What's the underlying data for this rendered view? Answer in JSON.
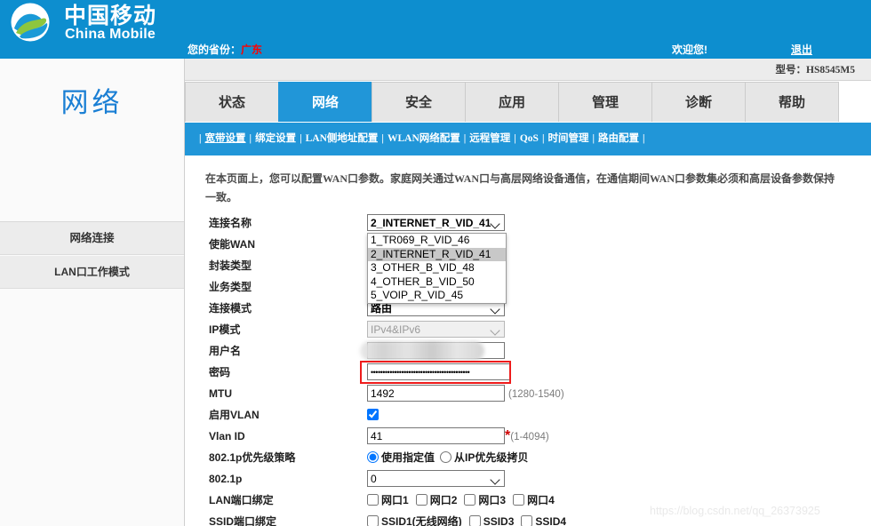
{
  "header": {
    "brand_cn": "中国移动",
    "brand_en": "China Mobile",
    "logo_icon": "china-mobile-logo-icon",
    "province_label": "您的省份：",
    "province_value": "广东",
    "welcome": "欢迎您!",
    "logout": "退出",
    "model_text": "型号：HS8545M5",
    "blue": "#0d8ecf"
  },
  "sidebar": {
    "title": "网络",
    "items": [
      {
        "label": "网络连接"
      },
      {
        "label": "LAN口工作模式"
      }
    ]
  },
  "tabs": [
    {
      "label": "状态",
      "active": false
    },
    {
      "label": "网络",
      "active": true
    },
    {
      "label": "安全",
      "active": false
    },
    {
      "label": "应用",
      "active": false
    },
    {
      "label": "管理",
      "active": false
    },
    {
      "label": "诊断",
      "active": false
    },
    {
      "label": "帮助",
      "active": false
    }
  ],
  "subnav": {
    "items": [
      {
        "label": "宽带设置",
        "current": true
      },
      {
        "label": "绑定设置",
        "current": false
      },
      {
        "label": "LAN侧地址配置",
        "current": false
      },
      {
        "label": "WLAN网络配置",
        "current": false
      },
      {
        "label": "远程管理",
        "current": false
      },
      {
        "label": "QoS",
        "current": false
      },
      {
        "label": "时间管理",
        "current": false
      },
      {
        "label": "路由配置",
        "current": false
      }
    ],
    "separator": "|"
  },
  "content": {
    "description": "在本页面上，您可以配置WAN口参数。家庭网关通过WAN口与高层网络设备通信，在通信期间WAN口参数集必须和高层设备参数保持一致。",
    "fields": {
      "connection_name": {
        "label": "连接名称",
        "value": "2_INTERNET_R_VID_41",
        "options": [
          "1_TR069_R_VID_46",
          "2_INTERNET_R_VID_41",
          "3_OTHER_B_VID_48",
          "4_OTHER_B_VID_50",
          "5_VOIP_R_VID_45"
        ],
        "selected_index": 1,
        "open": true
      },
      "enable_wan": {
        "label": "使能WAN"
      },
      "encapsulation_type": {
        "label": "封装类型"
      },
      "service_type": {
        "label": "业务类型"
      },
      "connection_mode": {
        "label": "连接模式",
        "value": "路由"
      },
      "ip_mode": {
        "label": "IP模式",
        "value": "IPv4&IPv6",
        "disabled": true
      },
      "username": {
        "label": "用户名",
        "value": "",
        "redacted": true
      },
      "password": {
        "label": "密码",
        "value": "••••••••••••••••••••••••••••••••••••••••••",
        "highlighted": true
      },
      "mtu": {
        "label": "MTU",
        "value": "1492",
        "hint": "(1280-1540)"
      },
      "enable_vlan": {
        "label": "启用VLAN",
        "checked": true
      },
      "vlan_id": {
        "label": "Vlan ID",
        "value": "41",
        "required_mark": "*",
        "hint": "(1-4094)"
      },
      "priority_policy": {
        "label": "802.1p优先级策略",
        "options": [
          {
            "label": "使用指定值",
            "checked": true
          },
          {
            "label": "从IP优先级拷贝",
            "checked": false
          }
        ]
      },
      "dot1p": {
        "label": "802.1p",
        "value": "0"
      },
      "lan_port_binding": {
        "label": "LAN端口绑定",
        "ports": [
          {
            "label": "网口1",
            "checked": false
          },
          {
            "label": "网口2",
            "checked": false
          },
          {
            "label": "网口3",
            "checked": false
          },
          {
            "label": "网口4",
            "checked": false
          }
        ]
      },
      "ssid_port_binding": {
        "label": "SSID端口绑定",
        "ports": [
          {
            "label": "SSID1(无线网络)",
            "checked": false
          },
          {
            "label": "SSID3",
            "checked": false
          },
          {
            "label": "SSID4",
            "checked": false
          }
        ]
      }
    }
  },
  "watermark": "https://blog.csdn.net/qq_26373925",
  "colors": {
    "brand_blue": "#0d8ecf",
    "tab_active": "#2196d8",
    "alert_red": "#ee1c1c",
    "sidebar_title": "#1a7fd4"
  }
}
